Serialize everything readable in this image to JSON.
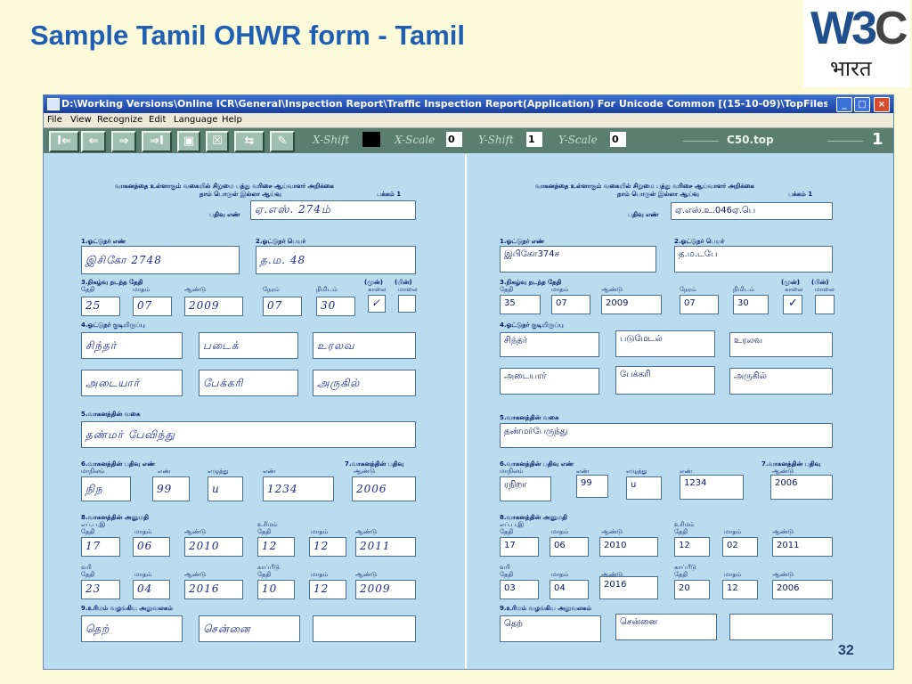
{
  "slide": {
    "title": "Sample Tamil OHWR form - Tamil",
    "page_number": "32",
    "logo_text": "W3",
    "logo_c": "C",
    "logo_sub": "भारत"
  },
  "window": {
    "title": "D:\\Working Versions\\Online ICR\\General\\Inspection Report\\Traffic Inspection Report(Application) For Unicode Common [(15-10-09)\\TopFiles 25-0...",
    "min_label": "_",
    "max_label": "□",
    "close_label": "×"
  },
  "menu": [
    "File",
    "View",
    "Recognize",
    "Edit",
    "Language",
    "Help"
  ],
  "toolbar": {
    "buttons": [
      "I⇐",
      "⇐",
      "⇒",
      "⇒I",
      "▣",
      "☒",
      "⇆",
      "✎"
    ],
    "xshift_label": "X-Shift",
    "xscale_label": "X-Scale",
    "xscale_value": "0",
    "yshift_label": "Y-Shift",
    "yshift_value": "1",
    "yscale_label": "Y-Scale",
    "yscale_value": "0",
    "file_name": "C50.top",
    "page": "1"
  },
  "left": {
    "header1": "வாகனத்தை உள்ளாகும் வகையில் சிறுமை பத்து வரிசை ஆய்வாளர் அறிக்கை",
    "header2": "நாம் பொருள் இல்லா ஆய்வு",
    "sheet": "பக்கம் 1",
    "reg_label": "பதிவு எண்",
    "reg_value": "ஏ.எஸ். 274ம்",
    "f1_label": "1.ஓட்டுநர் எண்",
    "f1_value": "இசிகோ 2748",
    "f2_label": "2.ஓட்டுநர் பெயர்",
    "f2_value": "த.ம. 48",
    "f3_label": "3.நிகழ்வு நடந்த தேதி",
    "f3_day_label": "தேதி",
    "f3_month_label": "மாதம்",
    "f3_year_label": "ஆண்டு",
    "f3_hour_label": "நேரம்",
    "f3_min_label": "நிமிடம்",
    "f3_am_label": "காலை",
    "f3_pm_label": "மாலை",
    "f3_am_head": "(முன்)",
    "f3_pm_head": "(பின்)",
    "f3_day": "25",
    "f3_month": "07",
    "f3_year": "2009",
    "f3_hour": "07",
    "f3_min": "30",
    "f3_check": "✓",
    "f4_label": "4.ஓட்டுநர் குடியிருப்பு",
    "f4_values": [
      "சிந்தர்",
      "படைக்",
      "உரலவ",
      "அடையார்",
      "பேக்கரி",
      "அருகில்"
    ],
    "f5_label": "5.வாகனத்தின் வகை",
    "f5_value": "தண்மர் பேவிந்து",
    "f6_label": "6.வாகனத்தின் பதிவு எண்",
    "f6_sub1": "மாநிலம்",
    "f6_sub2": "எண்",
    "f6_sub3": "எழுத்து",
    "f6_sub4": "எண்",
    "f6_values": [
      "நிந",
      "99",
      "u",
      "1234"
    ],
    "f7_label": "7.வாகனத்தின் பதிவு",
    "f7_sub": "ஆண்டு",
    "f7_value": "2006",
    "f8_label": "8.வாகனத்தின் அனுமதி",
    "f8_from": "எப்.ப.இ",
    "f8_to": "உரிமம்",
    "f8_day_label": "தேதி",
    "f8_month_label": "மாதம்",
    "f8_year_label": "ஆண்டு",
    "f8_row1": [
      "17",
      "06",
      "2010",
      "12",
      "12",
      "2011"
    ],
    "f8_tax": "வரி",
    "f8_cap": "காப்பீடு",
    "f8_row2": [
      "23",
      "04",
      "2016",
      "10",
      "12",
      "2009"
    ],
    "f9_label": "9.உரிமம் வழங்கிய அலுவலகம்",
    "f9_values": [
      "தெற்",
      "சென்னை",
      ""
    ]
  },
  "right": {
    "header1": "வாகனத்தை உள்ளாகும் வகையில் சிறுமை பத்து வரிசை ஆய்வாளர் அறிக்கை",
    "header2": "நாம் பொருள் இல்லா ஆய்வு",
    "sheet": "பக்கம் 1",
    "reg_label": "பதிவு எண்",
    "reg_value": "ஏ.எஸ்.உ.046ஏ.பெ",
    "f1_label": "1.ஓட்டுநர் எண்",
    "f1_value": "இபிகோ374ச",
    "f2_label": "2.ஓட்டுநர் பெயர்",
    "f2_value": "த.ம.டபே",
    "f3_label": "3.நிகழ்வு நடந்த தேதி",
    "f3_day_label": "தேதி",
    "f3_month_label": "மாதம்",
    "f3_year_label": "ஆண்டு",
    "f3_hour_label": "நேரம்",
    "f3_min_label": "நிமிடம்",
    "f3_am_label": "காலை",
    "f3_pm_label": "மாலை",
    "f3_am_head": "(முன்)",
    "f3_pm_head": "(பின்)",
    "f3_day": "35",
    "f3_month": "07",
    "f3_year": "2009",
    "f3_hour": "07",
    "f3_min": "30",
    "f3_check": "✓",
    "f4_label": "4.ஓட்டுநர் குடியிருப்பு",
    "f4_values": [
      "சிந்தர்",
      "படுமேடல்",
      "உரலவ",
      "அடையார்",
      "பேக்கரி",
      "அருகில்"
    ],
    "f5_label": "5.வாகனத்தின் வகை",
    "f5_value": "தண்மர்பேருந்து",
    "f6_label": "6.வாகனத்தின் பதிவு எண்",
    "f6_sub1": "மாநிலம்",
    "f6_sub2": "எண்",
    "f6_sub3": "எழுத்து",
    "f6_sub4": "எண்",
    "f6_values": [
      "ரநிறா",
      "99",
      "u",
      "1234"
    ],
    "f7_label": "7.வாகனத்தின் பதிவு",
    "f7_sub": "ஆண்டு",
    "f7_value": "2006",
    "f8_label": "8.வாகனத்தின் அனுமதி",
    "f8_from": "எப்.ப.இ",
    "f8_to": "உரிமம்",
    "f8_day_label": "தேதி",
    "f8_month_label": "மாதம்",
    "f8_year_label": "ஆண்டு",
    "f8_row1": [
      "17",
      "06",
      "2010",
      "12",
      "02",
      "2011"
    ],
    "f8_tax": "வரி",
    "f8_cap": "காப்பீடு",
    "f8_row2": [
      "03",
      "04",
      "2016",
      "20",
      "12",
      "2006"
    ],
    "f9_label": "9.உரிமம் வழங்கிய அலுவலகம்",
    "f9_values": [
      "தெற்",
      "சென்னை",
      ""
    ]
  },
  "colors": {
    "slide_bg": "#fbfbd9",
    "title": "#1f5fb3",
    "form_bg": "#b9dcee",
    "titlebar": "#1b3f9e",
    "toolbar": "#5a7e6f",
    "ink": "#1a2a8c"
  }
}
